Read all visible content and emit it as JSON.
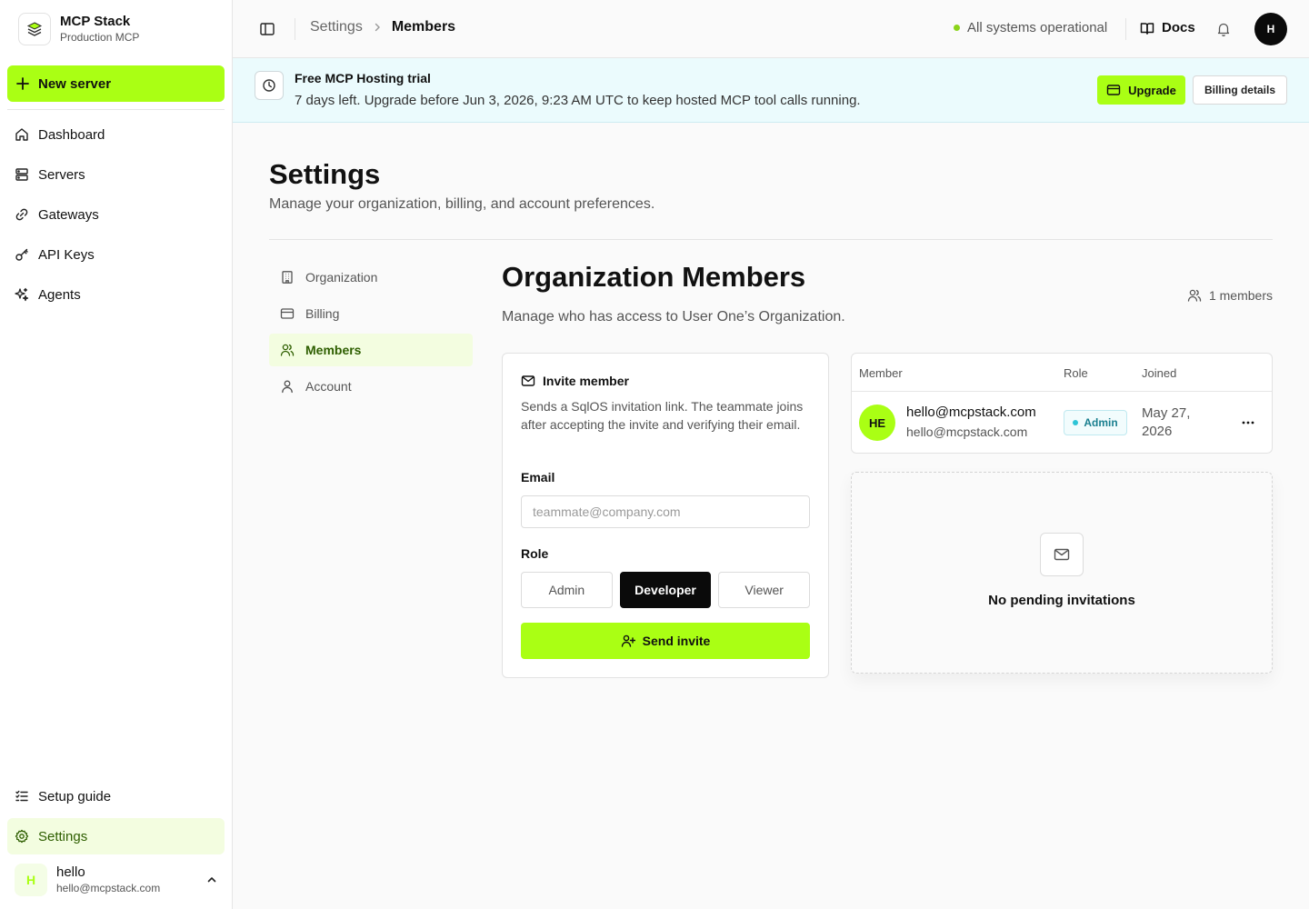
{
  "brand": {
    "name": "MCP Stack",
    "subtitle": "Production MCP"
  },
  "sidebar": {
    "new_server_label": "New server",
    "items": [
      {
        "label": "Dashboard",
        "icon": "home-icon"
      },
      {
        "label": "Servers",
        "icon": "server-icon"
      },
      {
        "label": "Gateways",
        "icon": "link-icon"
      },
      {
        "label": "API Keys",
        "icon": "key-icon"
      },
      {
        "label": "Agents",
        "icon": "sparkles-icon"
      }
    ],
    "bottom_items": [
      {
        "label": "Setup guide",
        "icon": "checklist-icon"
      },
      {
        "label": "Settings",
        "icon": "gear-icon",
        "active": true
      }
    ],
    "user": {
      "initial": "H",
      "name": "hello",
      "email": "hello@mcpstack.com"
    }
  },
  "header": {
    "breadcrumb": [
      "Settings",
      "Members"
    ],
    "status_text": "All systems operational",
    "docs_label": "Docs",
    "avatar_initial": "H"
  },
  "banner": {
    "title": "Free MCP Hosting trial",
    "text": "7 days left. Upgrade before Jun 3, 2026, 9:23 AM UTC to keep hosted MCP tool calls running.",
    "upgrade_label": "Upgrade",
    "billing_label": "Billing details"
  },
  "page": {
    "title": "Settings",
    "subtitle": "Manage your organization, billing, and account preferences."
  },
  "settings_nav": [
    {
      "label": "Organization",
      "icon": "building-icon"
    },
    {
      "label": "Billing",
      "icon": "credit-card-icon"
    },
    {
      "label": "Members",
      "icon": "users-icon",
      "active": true
    },
    {
      "label": "Account",
      "icon": "user-icon"
    }
  ],
  "members_section": {
    "title": "Organization Members",
    "subtitle": "Manage who has access to User One’s Organization.",
    "count_label": "1 members"
  },
  "invite": {
    "title": "Invite member",
    "description": "Sends a SqlOS invitation link. The teammate joins after accepting the invite and verifying their email.",
    "email_label": "Email",
    "email_placeholder": "teammate@company.com",
    "email_value": "",
    "role_label": "Role",
    "roles": [
      "Admin",
      "Developer",
      "Viewer"
    ],
    "selected_role": "Developer",
    "send_label": "Send invite"
  },
  "members_table": {
    "columns": [
      "Member",
      "Role",
      "Joined"
    ],
    "rows": [
      {
        "initials": "HE",
        "email": "hello@mcpstack.com",
        "secondary": "hello@mcpstack.com",
        "role": "Admin",
        "joined": "May 27, 2026"
      }
    ]
  },
  "pending": {
    "empty_text": "No pending invitations"
  },
  "colors": {
    "accent": "#aaff14",
    "status_dot": "#8bd41a",
    "banner_bg": "#ebfbfd",
    "badge": "#1a7f8f"
  }
}
